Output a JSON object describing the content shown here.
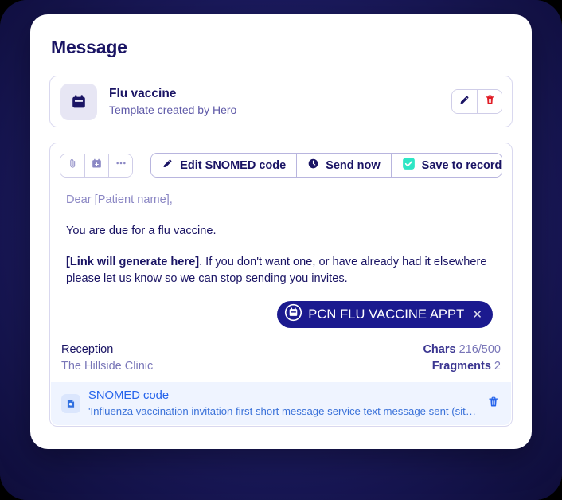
{
  "page": {
    "title": "Message",
    "backdrop_color": "#1b1a5e",
    "accent_color": "#1a1464",
    "teal_color": "#2ee6c5",
    "link_color": "#2563eb"
  },
  "template_card": {
    "icon": "calendar-icon",
    "title": "Flu vaccine",
    "subtitle": "Template created by Hero",
    "actions": [
      {
        "name": "edit-template-button",
        "icon": "pencil-icon"
      },
      {
        "name": "delete-template-button",
        "icon": "trash-icon"
      }
    ]
  },
  "editor": {
    "icon_buttons": [
      {
        "name": "attach-button",
        "icon": "paperclip-icon"
      },
      {
        "name": "add-appointment-button",
        "icon": "calendar-plus-icon"
      },
      {
        "name": "more-options-button",
        "icon": "ellipsis-icon"
      }
    ],
    "buttons": [
      {
        "name": "edit-snomed-code-button",
        "icon": "pencil-icon",
        "label": "Edit SNOMED code"
      },
      {
        "name": "send-now-button",
        "icon": "clock-icon",
        "label": "Send now"
      },
      {
        "name": "save-to-record-button",
        "icon": "checkbox-checked-icon",
        "label": "Save to record",
        "checked": true
      }
    ],
    "body": {
      "salutation": "Dear [Patient name],",
      "paragraph_1": "You are due for a flu vaccine.",
      "paragraph_2_bold": "[Link will generate here]",
      "paragraph_2_rest": ". If you don't want one, or have already had it elsewhere please let us know so we can stop sending you invites."
    },
    "badge": {
      "icon": "calendar-circle-icon",
      "label": "PCN FLU VACCINE APPT",
      "close_icon": "close-icon"
    },
    "meta": {
      "sender_name": "Reception",
      "sender_org": "The Hillside Clinic",
      "chars_label": "Chars",
      "chars_value": "216/500",
      "fragments_label": "Fragments",
      "fragments_value": "2"
    },
    "snomed": {
      "icon": "snomed-code-icon",
      "title": "SNOMED code",
      "description": "'Influenza vaccination invitation first short message service text message sent (situat...",
      "delete_icon": "trash-icon"
    }
  }
}
